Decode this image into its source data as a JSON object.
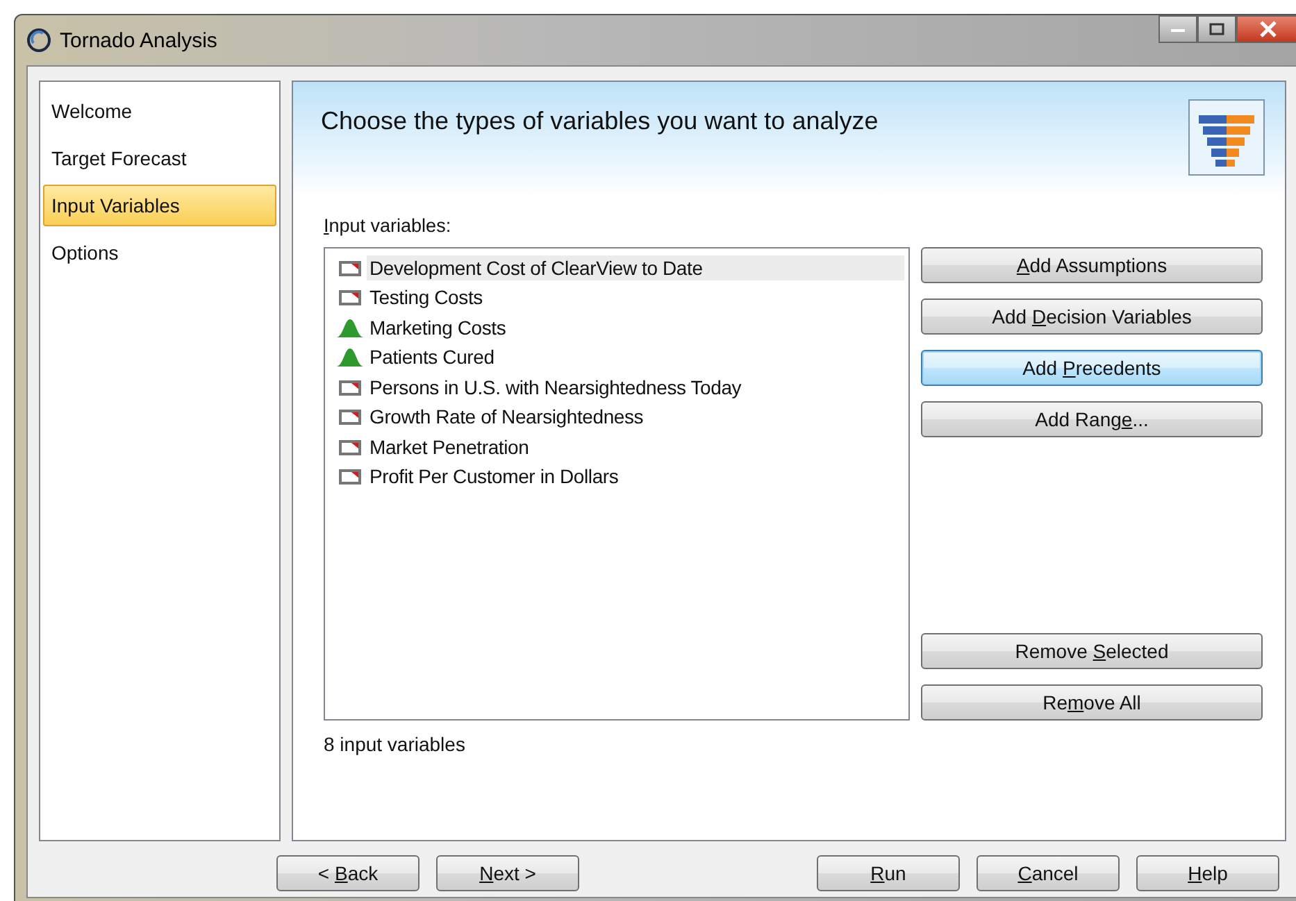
{
  "window": {
    "title": "Tornado Analysis"
  },
  "sidebar": {
    "items": [
      {
        "label": "Welcome",
        "selected": false
      },
      {
        "label": "Target Forecast",
        "selected": false
      },
      {
        "label": "Input Variables",
        "selected": true
      },
      {
        "label": "Options",
        "selected": false
      }
    ]
  },
  "header": {
    "title": "Choose the types of variables you want to analyze"
  },
  "list_label": {
    "key": "I",
    "after": "nput variables:"
  },
  "variables": [
    {
      "name": "Development Cost of ClearView to Date",
      "kind": "precedent",
      "selected": true
    },
    {
      "name": "Testing Costs",
      "kind": "precedent",
      "selected": false
    },
    {
      "name": "Marketing Costs",
      "kind": "assumption",
      "selected": false
    },
    {
      "name": "Patients Cured",
      "kind": "assumption",
      "selected": false
    },
    {
      "name": "Persons in U.S. with Nearsightedness Today",
      "kind": "precedent",
      "selected": false
    },
    {
      "name": "Growth Rate of Nearsightedness",
      "kind": "precedent",
      "selected": false
    },
    {
      "name": "Market Penetration",
      "kind": "precedent",
      "selected": false
    },
    {
      "name": "Profit Per Customer in Dollars",
      "kind": "precedent",
      "selected": false
    }
  ],
  "side_buttons": [
    {
      "label": {
        "key": "A",
        "after": "dd Assumptions"
      },
      "focused": false
    },
    {
      "label": {
        "before": "Add ",
        "key": "D",
        "after": "ecision Variables"
      },
      "focused": false
    },
    {
      "label": {
        "before": "Add ",
        "key": "P",
        "after": "recedents"
      },
      "focused": true
    },
    {
      "label": {
        "before": "Add Rang",
        "key": "e",
        "after": "..."
      },
      "focused": false
    }
  ],
  "remove_buttons": [
    {
      "label": {
        "before": "Remove ",
        "key": "S",
        "after": "elected"
      },
      "focused": false
    },
    {
      "label": {
        "before": "Re",
        "key": "m",
        "after": "ove All"
      },
      "focused": false
    }
  ],
  "count": "8 input variables",
  "nav_buttons": [
    {
      "label": {
        "before": "< ",
        "key": "B",
        "after": "ack"
      }
    },
    {
      "label": {
        "key": "N",
        "after": "ext >"
      }
    }
  ],
  "action_buttons": [
    {
      "label": {
        "key": "R",
        "after": "un"
      }
    },
    {
      "label": {
        "key": "C",
        "after": "ancel"
      }
    },
    {
      "label": {
        "key": "H",
        "after": "elp"
      }
    }
  ]
}
